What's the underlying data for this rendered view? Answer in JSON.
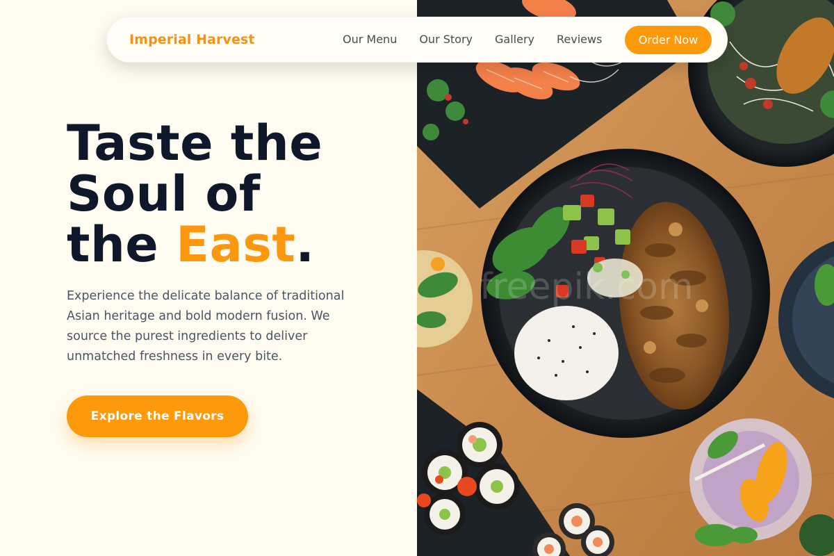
{
  "nav": {
    "brand": "Imperial Harvest",
    "links": [
      "Our Menu",
      "Our Story",
      "Gallery",
      "Reviews"
    ],
    "cta_label": "Order Now"
  },
  "hero": {
    "headline_line1": "Taste the",
    "headline_line2": "Soul of",
    "headline_line3_prefix": "the ",
    "headline_accent": "East",
    "headline_suffix": ".",
    "lead": "Experience the delicate balance of traditional Asian heritage and bold modern fusion. We source the purest ingredients to deliver unmatched freshness in every bite.",
    "cta_label": "Explore the Flavors",
    "photo_subject": "overhead photo of Asian dishes: rice bowl, sushi rolls, salmon sashimi, salads"
  },
  "colors": {
    "accent": "#fd9a0c",
    "background": "#fefbf0",
    "heading": "#0f172a",
    "body_text": "#4b5563"
  }
}
